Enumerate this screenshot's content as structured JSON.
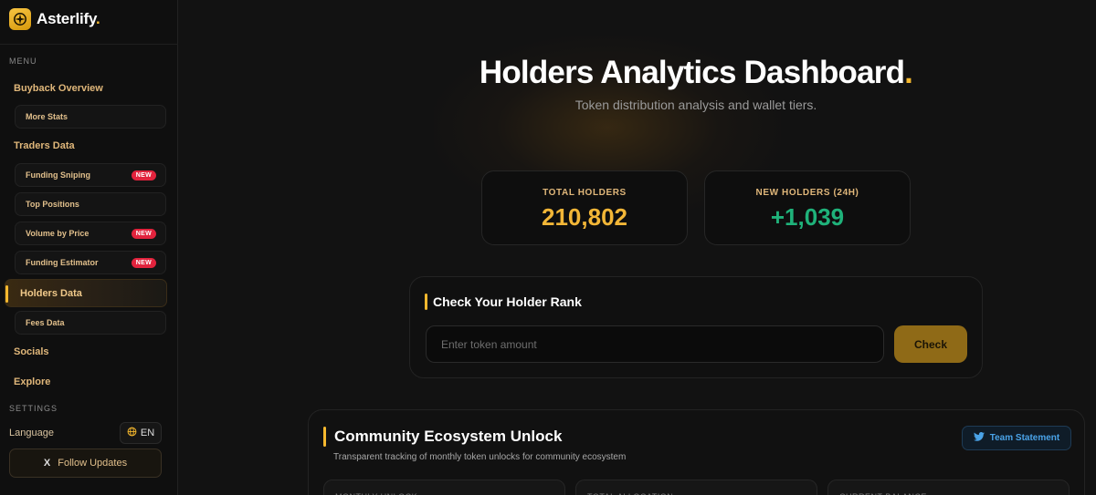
{
  "brand": {
    "name": "Asterlify",
    "dot": "."
  },
  "sidebar": {
    "menu_label": "MENU",
    "settings_label": "SETTINGS",
    "buyback_overview": "Buyback Overview",
    "more_stats": "More Stats",
    "traders_data": "Traders Data",
    "funding_sniping": "Funding Sniping",
    "top_positions": "Top Positions",
    "volume_by_price": "Volume by Price",
    "funding_estimator": "Funding Estimator",
    "holders_data": "Holders Data",
    "fees_data": "Fees Data",
    "socials": "Socials",
    "explore": "Explore",
    "new_badge": "NEW",
    "language_label": "Language",
    "language_value": "EN",
    "follow_updates": "Follow Updates",
    "x_glyph": "X"
  },
  "header": {
    "title": "Holders Analytics Dashboard",
    "title_dot": ".",
    "subtitle": "Token distribution analysis and wallet tiers."
  },
  "stats": {
    "total_holders_label": "TOTAL HOLDERS",
    "total_holders_value": "210,802",
    "new_holders_label": "NEW HOLDERS (24H)",
    "new_holders_value": "+1,039"
  },
  "rank": {
    "title": "Check Your Holder Rank",
    "input_placeholder": "Enter token amount",
    "check_label": "Check"
  },
  "community": {
    "title": "Community Ecosystem Unlock",
    "subtitle": "Transparent tracking of monthly token unlocks for community ecosystem",
    "team_statement": "Team Statement",
    "cards": [
      "MONTHLY UNLOCK",
      "TOTAL ALLOCATION",
      "CURRENT BALANCE"
    ]
  },
  "colors": {
    "accent": "#f5b82e",
    "gold_value": "#f2b637",
    "green_value": "#1fb27a",
    "new_badge": "#e2233d",
    "twitter_blue": "#4aa3e8"
  },
  "icons": {
    "logo": "compass-star-icon",
    "language": "globe-icon",
    "follow": "x-logo-icon",
    "team": "twitter-bird-icon"
  }
}
